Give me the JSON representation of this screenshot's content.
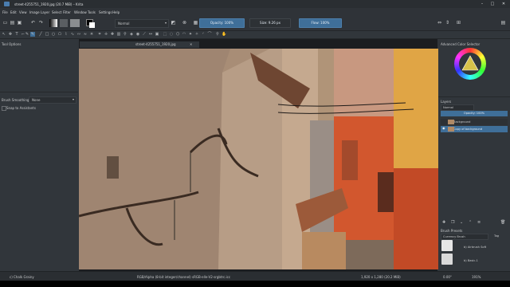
{
  "window": {
    "title": "street-4255751_1920.jpg (20.7 MiB)  – Krita",
    "controls": [
      "–",
      "□",
      "✕"
    ]
  },
  "menu": [
    "File",
    "Edit",
    "View",
    "Image",
    "Layer",
    "Select",
    "Filter",
    "Window",
    "Tools",
    "Settings",
    "Help"
  ],
  "toolbar": {
    "blend_mode": "Normal",
    "opacity_label": "Opacity: 100%",
    "size_label": "Size: 9.26 px",
    "flow_label": "Flow: 100%"
  },
  "left_dock": {
    "title": "Tool Options",
    "smoothing_label": "Brush Smoothing:",
    "smoothing_value": "None",
    "snap_label": "Snap to Assistants"
  },
  "document_tab": "street-4255751_1920.jpg",
  "right_dock": {
    "color_selector_title": "Advanced Color Selector",
    "layers_title": "Layers",
    "layer_blend": "Normal",
    "layer_opacity": "Opacity: 100%",
    "layers": [
      {
        "name": "Background"
      },
      {
        "name": "Copy of background"
      }
    ],
    "brush_presets_title": "Brush Presets",
    "preset_filter": "Currency Brush",
    "preset_tag": "Tag",
    "presets": [
      {
        "name": "b) Airbrush Soft"
      },
      {
        "name": "b) Basic-1"
      }
    ]
  },
  "status": {
    "tool": "c) Chalk Grainy",
    "color_info": "RGB/Alpha (8-bit integer/channel)  sRGB-elle-V2-srgbtrc.icc",
    "dimensions": "1,920 x 1,280 (20.2 MiB)",
    "rotation": "0.00°",
    "zoom": "191%"
  },
  "colors": {
    "accent": "#3f6f99",
    "background": "#31363b"
  }
}
